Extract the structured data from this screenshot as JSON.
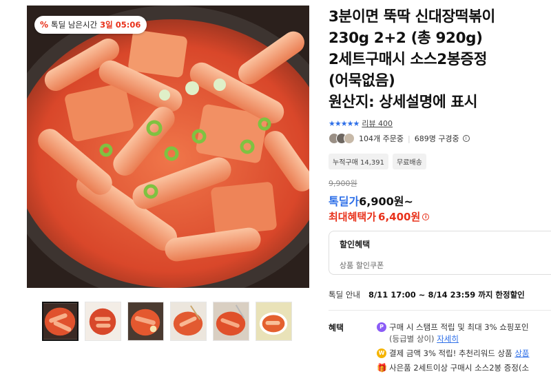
{
  "deal_timer": {
    "label": "톡딜 남은시간",
    "value": "3일 05:06"
  },
  "product": {
    "title": "3분이면 뚝딱 신대장떡볶이\n230g 2+2 (총 920g)\n2세트구매시 소스2봉증정\n(어묵없음)\n원산지: 상세설명에 표시",
    "rating": 4.5,
    "stars": "★★★★★",
    "review_text": "리뷰 400",
    "order_count": "104개 주문중",
    "watching_count": "689명 구경중",
    "tags": [
      "누적구매 14,391",
      "무료배송"
    ],
    "original_price": "9,900원",
    "deal_price_label": "톡딜가",
    "deal_price_value": "6,900원~",
    "max_benefit_label": "최대혜택가",
    "max_benefit_value": "6,400원"
  },
  "discount": {
    "title": "할인혜택",
    "subtitle": "상품 할인쿠폰"
  },
  "deal_guide": {
    "label": "톡딜 안내",
    "value": "8/11 17:00 ~ 8/14 23:59 까지 한정할인"
  },
  "benefits": {
    "label": "혜택",
    "items": [
      {
        "icon": "point-icon",
        "text": "구매 시 스탬프 적립 및 최대 3% 쇼핑포인",
        "sub": "(등급별 상이)",
        "link": "자세히"
      },
      {
        "icon": "coin-icon",
        "text": "결제 금액 3% 적립! 추천리워드 상품",
        "link": "상품"
      },
      {
        "icon": "gift-icon",
        "text": "사은품 2세트이상 구매시 소스2봉 증정(소"
      }
    ]
  },
  "thumbnails": [
    "thumb-1",
    "thumb-2",
    "thumb-3",
    "thumb-4",
    "thumb-5",
    "thumb-6"
  ],
  "colors": {
    "accent_blue": "#2e6fe8",
    "accent_red": "#e8311a",
    "sauce": "#e2532c",
    "rice_cake": "#f4a27a"
  }
}
